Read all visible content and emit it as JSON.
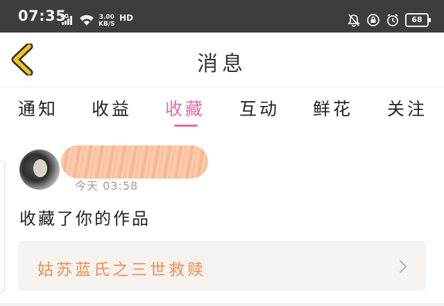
{
  "status_bar": {
    "time": "07:35",
    "network": "4G",
    "speed_value": "3.00",
    "speed_unit": "KB/S",
    "hd": "HD",
    "battery": "68",
    "icons": [
      "signal-icon",
      "wifi-icon",
      "mute-icon",
      "lock-rotation-icon",
      "alarm-icon",
      "battery-icon"
    ]
  },
  "header": {
    "title": "消息",
    "back_icon": "chevron-left-icon"
  },
  "tabs": [
    {
      "label": "通知"
    },
    {
      "label": "收益"
    },
    {
      "label": "收藏"
    },
    {
      "label": "互动"
    },
    {
      "label": "鲜花"
    },
    {
      "label": "关注"
    }
  ],
  "active_tab": "收藏",
  "notification": {
    "time": "今天 03:58",
    "message": "收藏了你的作品",
    "work_title": "姑苏蓝氏之三世救赎"
  },
  "colors": {
    "status_bar_bg": "#3d3d3f",
    "accent_pink": "#e76aa0",
    "back_icon_yellow": "#f2c21a",
    "work_title_orange": "#ef8d53",
    "card_bg": "#f5f3ef"
  }
}
